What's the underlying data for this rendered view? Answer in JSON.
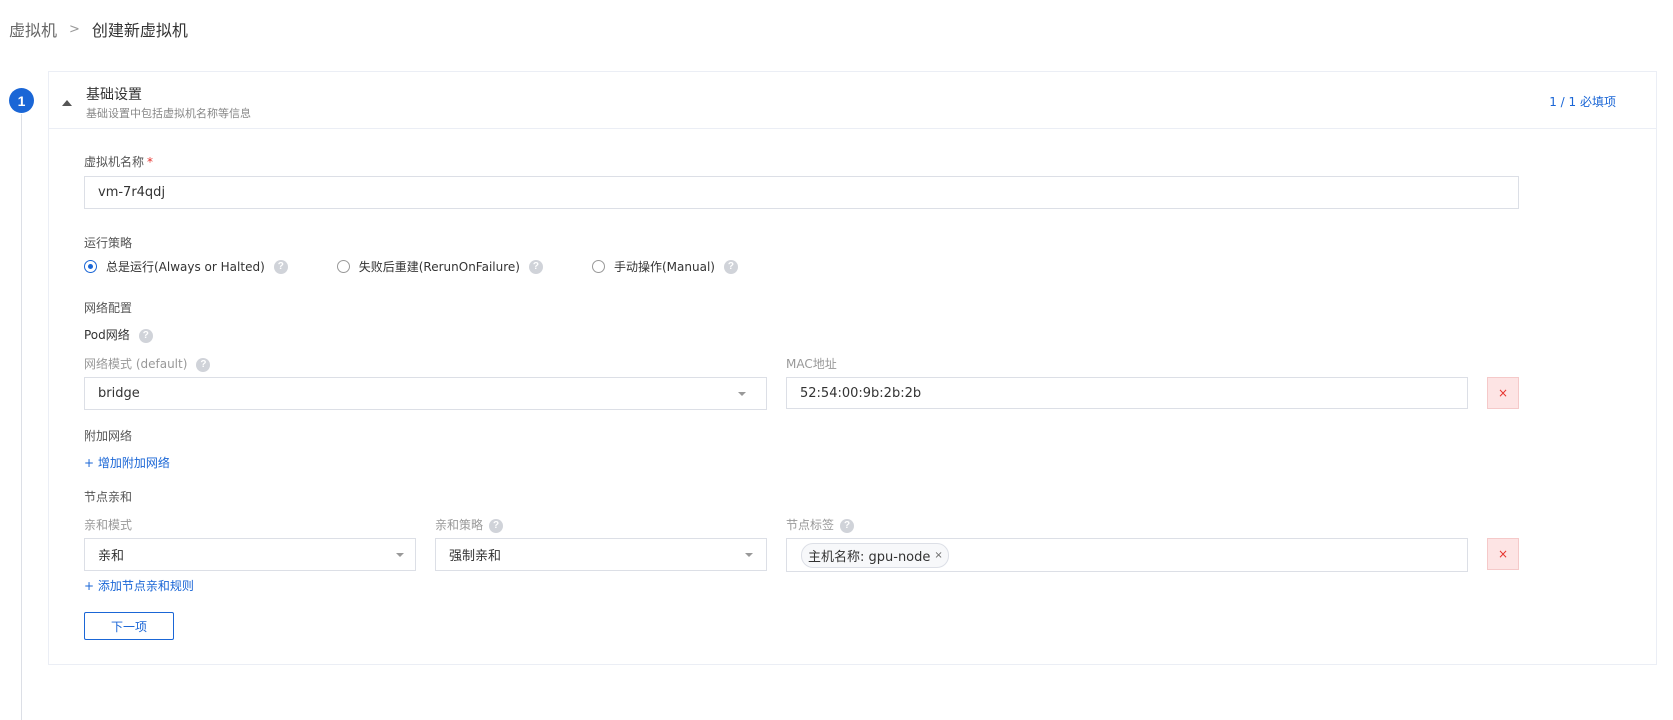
{
  "breadcrumb": {
    "root": "虚拟机",
    "separator": ">",
    "current": "创建新虚拟机"
  },
  "step": {
    "number": "1",
    "title": "基础设置",
    "subtitle": "基础设置中包括虚拟机名称等信息",
    "required_status": "1 / 1 必填项"
  },
  "vm_name": {
    "label": "虚拟机名称",
    "required_mark": "*",
    "value": "vm-7r4qdj"
  },
  "run_strategy": {
    "label": "运行策略",
    "options": [
      {
        "label": "总是运行(Always or Halted)",
        "checked": true
      },
      {
        "label": "失败后重建(RerunOnFailure)",
        "checked": false
      },
      {
        "label": "手动操作(Manual)",
        "checked": false
      }
    ],
    "help_glyph": "?"
  },
  "network": {
    "section_label": "网络配置",
    "pod_network_label": "Pod网络",
    "mode_label": "网络模式 (default)",
    "mode_value": "bridge",
    "mac_label": "MAC地址",
    "mac_value": "52:54:00:9b:2b:2b",
    "delete_glyph": "×"
  },
  "additional_network": {
    "label": "附加网络",
    "add_link": "+ 增加附加网络"
  },
  "node_affinity": {
    "section_label": "节点亲和",
    "mode_label": "亲和模式",
    "mode_value": "亲和",
    "policy_label": "亲和策略",
    "policy_value": "强制亲和",
    "labels_label": "节点标签",
    "tag_text": "主机名称: gpu-node",
    "tag_close": "×",
    "delete_glyph": "×",
    "add_link": "+ 添加节点亲和规则"
  },
  "actions": {
    "next_label": "下一项"
  },
  "colors": {
    "accent": "#1a66d6",
    "danger": "#e6322d",
    "danger_bg": "#fde4e4",
    "border": "#dcdfe6"
  }
}
